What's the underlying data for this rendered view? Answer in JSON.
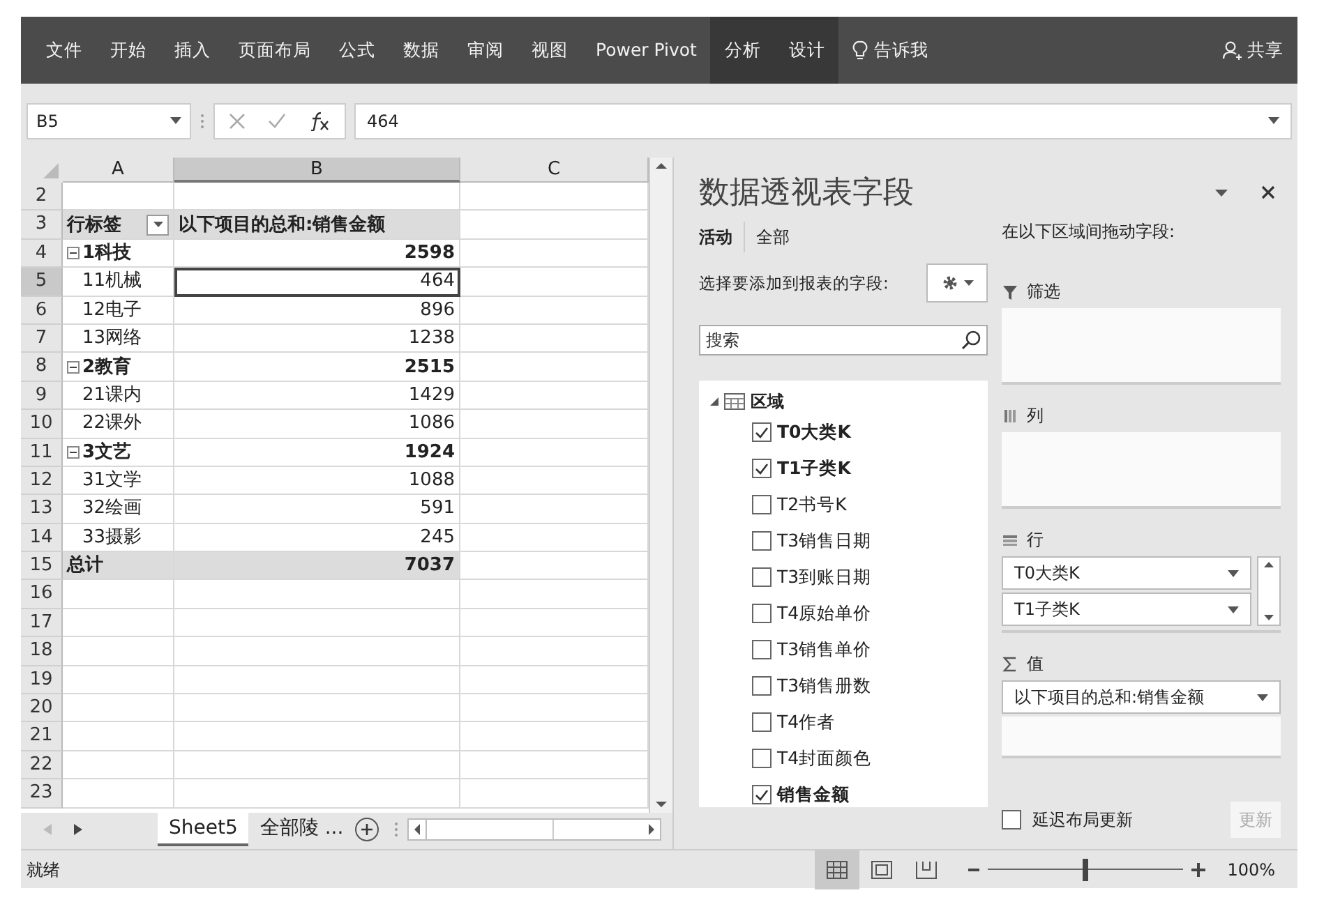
{
  "ribbon": {
    "tabs": [
      {
        "label": "文件",
        "contextual": false
      },
      {
        "label": "开始",
        "contextual": false
      },
      {
        "label": "插入",
        "contextual": false
      },
      {
        "label": "页面布局",
        "contextual": false
      },
      {
        "label": "公式",
        "contextual": false
      },
      {
        "label": "数据",
        "contextual": false
      },
      {
        "label": "审阅",
        "contextual": false
      },
      {
        "label": "视图",
        "contextual": false
      },
      {
        "label": "Power Pivot",
        "contextual": false
      },
      {
        "label": "分析",
        "contextual": true
      },
      {
        "label": "设计",
        "contextual": true
      }
    ],
    "tell_me": "告诉我",
    "share": "共享"
  },
  "formula_bar": {
    "name_box": "B5",
    "value": "464"
  },
  "grid": {
    "columns": [
      {
        "label": "A",
        "selected": false
      },
      {
        "label": "B",
        "selected": true
      },
      {
        "label": "C",
        "selected": false
      }
    ],
    "rows": [
      {
        "number": "2",
        "kind": "empty",
        "selected": false
      },
      {
        "number": "3",
        "kind": "header",
        "selected": false,
        "label": "行标签",
        "value": "以下项目的总和:销售金额"
      },
      {
        "number": "4",
        "kind": "group",
        "selected": false,
        "label": "1科技",
        "value": "2598"
      },
      {
        "number": "5",
        "kind": "item",
        "selected": true,
        "label": "11机械",
        "value": "464"
      },
      {
        "number": "6",
        "kind": "item",
        "selected": false,
        "label": "12电子",
        "value": "896"
      },
      {
        "number": "7",
        "kind": "item",
        "selected": false,
        "label": "13网络",
        "value": "1238"
      },
      {
        "number": "8",
        "kind": "group",
        "selected": false,
        "label": "2教育",
        "value": "2515"
      },
      {
        "number": "9",
        "kind": "item",
        "selected": false,
        "label": "21课内",
        "value": "1429"
      },
      {
        "number": "10",
        "kind": "item",
        "selected": false,
        "label": "22课外",
        "value": "1086"
      },
      {
        "number": "11",
        "kind": "group",
        "selected": false,
        "label": "3文艺",
        "value": "1924"
      },
      {
        "number": "12",
        "kind": "item",
        "selected": false,
        "label": "31文学",
        "value": "1088"
      },
      {
        "number": "13",
        "kind": "item",
        "selected": false,
        "label": "32绘画",
        "value": "591"
      },
      {
        "number": "14",
        "kind": "item",
        "selected": false,
        "label": "33摄影",
        "value": "245"
      },
      {
        "number": "15",
        "kind": "total",
        "selected": false,
        "label": "总计",
        "value": "7037"
      },
      {
        "number": "16",
        "kind": "empty",
        "selected": false
      },
      {
        "number": "17",
        "kind": "empty",
        "selected": false
      },
      {
        "number": "18",
        "kind": "empty",
        "selected": false
      },
      {
        "number": "19",
        "kind": "empty",
        "selected": false
      },
      {
        "number": "20",
        "kind": "empty",
        "selected": false
      },
      {
        "number": "21",
        "kind": "empty",
        "selected": false
      },
      {
        "number": "22",
        "kind": "empty",
        "selected": false
      },
      {
        "number": "23",
        "kind": "empty",
        "selected": false
      }
    ]
  },
  "sheet_tabs": [
    {
      "label": "Sheet5",
      "selected": true
    },
    {
      "label": "全部陵 ...",
      "selected": false
    }
  ],
  "pivot_pane": {
    "title": "数据透视表字段",
    "tabs": [
      {
        "label": "活动",
        "selected": true
      },
      {
        "label": "全部",
        "selected": false
      }
    ],
    "prompt": "选择要添加到报表的字段:",
    "search": {
      "placeholder": "搜索"
    },
    "tree": {
      "label": "区域",
      "expanded": true,
      "children": [
        {
          "label": "T0大类K",
          "checked": true
        },
        {
          "label": "T1子类K",
          "checked": true
        },
        {
          "label": "T2书号K",
          "checked": false
        },
        {
          "label": "T3销售日期",
          "checked": false
        },
        {
          "label": "T3到账日期",
          "checked": false
        },
        {
          "label": "T4原始单价",
          "checked": false
        },
        {
          "label": "T3销售单价",
          "checked": false
        },
        {
          "label": "T3销售册数",
          "checked": false
        },
        {
          "label": "T4作者",
          "checked": false
        },
        {
          "label": "T4封面颜色",
          "checked": false
        },
        {
          "label": "销售金额",
          "checked": true
        }
      ]
    },
    "hint": "在以下区域间拖动字段:",
    "areas": [
      {
        "kind": "filter",
        "label": "筛选"
      },
      {
        "kind": "columns",
        "label": "列"
      },
      {
        "kind": "rows",
        "label": "行",
        "items": [
          "T0大类K",
          "T1子类K"
        ]
      },
      {
        "kind": "values",
        "label": "值",
        "items": [
          "以下项目的总和:销售金额"
        ]
      }
    ],
    "defer_update": {
      "label": "延迟布局更新",
      "checked": false
    },
    "update_button": {
      "label": "更新",
      "disabled": true
    }
  },
  "status_bar": {
    "text": "就绪",
    "views": [
      {
        "kind": "normal",
        "selected": true
      },
      {
        "kind": "page_layout",
        "selected": false
      },
      {
        "kind": "page_break",
        "selected": false
      }
    ],
    "zoom": {
      "level": 0.5,
      "reading": "100%"
    }
  }
}
